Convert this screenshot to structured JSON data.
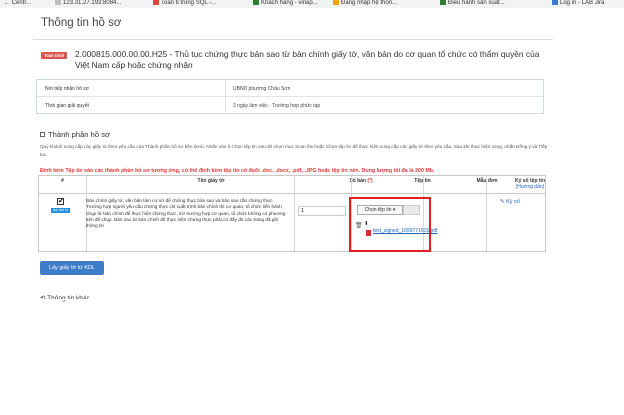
{
  "bookmarks": [
    {
      "label": "← Centr...",
      "icon": "page-icon",
      "color": "#999999"
    },
    {
      "label": "123.31.27.193:8084...",
      "icon": "page-icon",
      "color": "#aaaaaa"
    },
    {
      "label": "Toàn tỉ trong SQL -...",
      "icon": "page-icon",
      "color": "#e0443a"
    },
    {
      "label": "Khách hàng - vinap...",
      "icon": "sheet-icon",
      "color": "#2e7d32"
    },
    {
      "label": "Đăng nhập hệ thốn...",
      "icon": "star-icon",
      "color": "#f0a500"
    },
    {
      "label": "Điều hành sản xuất...",
      "icon": "sheet-icon",
      "color": "#2e7d32"
    },
    {
      "label": "Log in - LAB Jira",
      "icon": "page-icon",
      "color": "#3d7cc9"
    }
  ],
  "page": {
    "title": "Thông tin hồ sơ",
    "badge": "Toàn trình",
    "procedure_title": "2.000815.000.00.00.H25 - Thủ tục chứng thực bản sao từ bản chính giấy tờ, văn bản do cơ quan tổ chức có thẩm quyền của Việt Nam cấp hoặc chứng nhận"
  },
  "info": {
    "receive_label": "Nơi tiếp nhận hồ sơ",
    "receive_value": "UBND phường Châu Sơn",
    "time_label": "Thời gian giải quyết",
    "time_value": "2 ngày làm việc - Trường hợp phức tạp"
  },
  "components": {
    "heading": "Thành phần hồ sơ",
    "guide": "Quý khách cung cấp các giấy tờ theo yêu cầu của Thành phần hồ sơ bên dưới. Nhấn vào ô Chọn tệp tin sau đó chọn mục Scan file hoặc Chọn tệp tin để thực hiện cung cấp các giấy tờ theo yêu cầu. Sau khi thực hiện xong, nhấn Đồng ý và Tiếp tục.",
    "warning": "Đính kèm Tệp tin vào các thành phần hồ sơ tương ứng, có thể đính kèm tệp tin có đuôi .doc, .docx, .pdf, .JPG hoặc tệp tin nén. Dung lượng tối đa là 200 Mb.",
    "headers": {
      "index": "#",
      "name": "Tên giấy tờ",
      "copies": "Số bản",
      "required_mark": "(*)",
      "file": "Tệp tin",
      "template": "Mẫu đơn",
      "sign": "Ký số tệp tin",
      "sign_guide": "(Hướng dẫn)"
    },
    "row": {
      "tag": "Mặc định hồ sơ giấy",
      "name": "Bản chính giấy tờ, văn bản làm cơ sở để chứng thực bản sao và bản sao cần chứng thực. Trường hợp người yêu cầu chứng thực chỉ xuất trình bản chính thì cơ quan, tổ chức tiến hành chụp từ bản chính để thực hiện chứng thực, trừ trường hợp cơ quan, tổ chức không có phương tiện để chụp. Bản sao từ bản chính để thực hiện chứng thực phải có đầy đủ các trang đã ghi thông tin",
      "copies": "1",
      "choose_label": "Chọn tệp tin ▾",
      "file_name": "test_signed_1699771615.pdf",
      "sign_label": "Ký số"
    }
  },
  "actions": {
    "kdl_label": "Lấy giấy tờ từ KDL",
    "other_info": "Thông tin khác"
  }
}
